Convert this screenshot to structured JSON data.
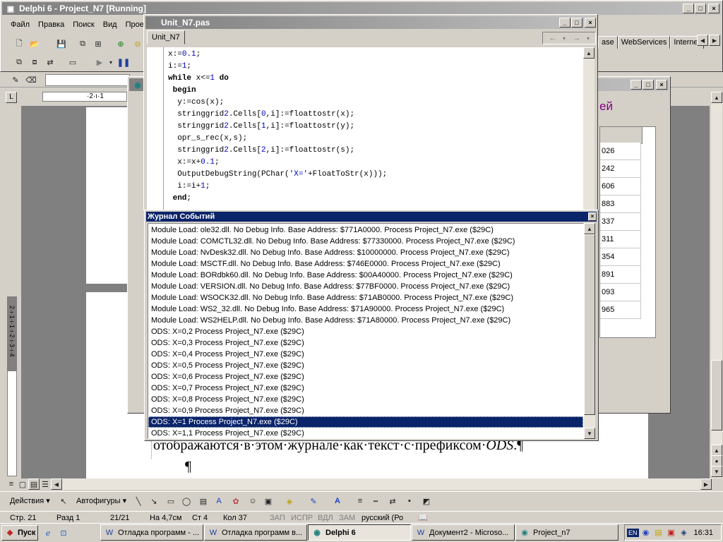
{
  "delphi": {
    "title": "Delphi 6 - Project_N7 [Running]",
    "menu": [
      "Файл",
      "Правка",
      "Поиск",
      "Вид",
      "Прое"
    ],
    "palette_tabs": [
      "ase",
      "WebServices",
      "Internet"
    ]
  },
  "editor": {
    "title": "Unit_N7.pas",
    "tab": "Unit_N7",
    "code": [
      "x:=0.1;",
      "i:=1;",
      "while x<=1 do",
      " begin",
      "  y:=cos(x);",
      "  stringgrid2.Cells[0,i]:=floattostr(x);",
      "  stringgrid2.Cells[1,i]:=floattostr(y);",
      "  opr_s_rec(x,s);",
      "  stringgrid2.Cells[2,i]:=floattostr(s);",
      "  x:=x+0.1;",
      "  OutputDebugString(PChar('X='+FloatToStr(x)));",
      "  i:=i+1;",
      " end;"
    ]
  },
  "event_log": {
    "title": "Журнал Событий",
    "selected_index": 17,
    "lines": [
      "Module Load: ole32.dll. No Debug Info. Base Address: $771A0000. Process Project_N7.exe ($29C)",
      "Module Load: COMCTL32.dll. No Debug Info. Base Address: $77330000. Process Project_N7.exe ($29C)",
      "Module Load: NvDesk32.dll. No Debug Info. Base Address: $10000000. Process Project_N7.exe ($29C)",
      "Module Load: MSCTF.dll. No Debug Info. Base Address: $746E0000. Process Project_N7.exe ($29C)",
      "Module Load: BORdbk60.dll. No Debug Info. Base Address: $00A40000. Process Project_N7.exe ($29C)",
      "Module Load: VERSION.dll. No Debug Info. Base Address: $77BF0000. Process Project_N7.exe ($29C)",
      "Module Load: WSOCK32.dll. No Debug Info. Base Address: $71AB0000. Process Project_N7.exe ($29C)",
      "Module Load: WS2_32.dll. No Debug Info. Base Address: $71A90000. Process Project_N7.exe ($29C)",
      "Module Load: WS2HELP.dll. No Debug Info. Base Address: $71A80000. Process Project_N7.exe ($29C)",
      "ODS: X=0,2 Process Project_N7.exe ($29C)",
      "ODS: X=0,3 Process Project_N7.exe ($29C)",
      "ODS: X=0,4 Process Project_N7.exe ($29C)",
      "ODS: X=0,5 Process Project_N7.exe ($29C)",
      "ODS: X=0,6 Process Project_N7.exe ($29C)",
      "ODS: X=0,7 Process Project_N7.exe ($29C)",
      "ODS: X=0,8 Process Project_N7.exe ($29C)",
      "ODS: X=0,9 Process Project_N7.exe ($29C)",
      "ODS: X=1 Process Project_N7.exe ($29C)",
      "ODS: X=1,1 Process Project_N7.exe ($29C)"
    ]
  },
  "project_form": {
    "title_fragment": "ей",
    "grid_values": [
      "026",
      "242",
      "606",
      "883",
      "337",
      "311",
      "354",
      "891",
      "093",
      "965"
    ]
  },
  "word": {
    "doc_text": "отображаются·в·этом·журнале·как·текст·с·префиксом·",
    "doc_text_italic": "ODS",
    "doc_text_end": ".¶",
    "pilcrow": "¶",
    "ruler_text": "·2·ı·1",
    "vruler_text": "2·ı·1·ı·1·ı·2·ı·3·ı·4",
    "draw_toolbar": {
      "actions": "Действия ▾",
      "autoshapes": "Автофигуры ▾"
    },
    "status": {
      "page": "Стр. 21",
      "section": "Разд 1",
      "pages": "21/21",
      "at": "На 4,7см",
      "line": "Ст 4",
      "col": "Кол 37",
      "rec": "ЗАП",
      "trk": "ИСПР",
      "ext": "ВДЛ",
      "ovr": "ЗАМ",
      "lang": "русский (Ро"
    }
  },
  "taskbar": {
    "start": "Пуск",
    "tasks": [
      "Отладка программ - ...",
      "Отладка программ в...",
      "Delphi 6",
      "Документ2 - Microso...",
      "Project_n7"
    ],
    "clock": "16:31",
    "lang": "EN"
  },
  "colors": {
    "title_active": "#0a246a",
    "title_inactive": "#808080",
    "selection": "#0a246a",
    "face": "#d4d0c8"
  }
}
